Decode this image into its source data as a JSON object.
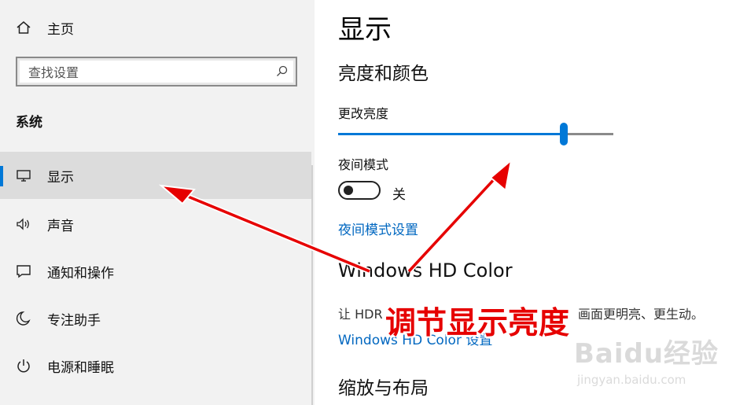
{
  "sidebar": {
    "home_label": "主页",
    "search_placeholder": "查找设置",
    "section_label": "系统",
    "items": [
      {
        "label": "显示",
        "icon": "monitor-icon"
      },
      {
        "label": "声音",
        "icon": "speaker-icon"
      },
      {
        "label": "通知和操作",
        "icon": "notification-icon"
      },
      {
        "label": "专注助手",
        "icon": "moon-icon"
      },
      {
        "label": "电源和睡眠",
        "icon": "power-icon"
      }
    ],
    "selected_index": 0
  },
  "main": {
    "title": "显示",
    "brightness_color_heading": "亮度和颜色",
    "brightness_label": "更改亮度",
    "brightness_value_percent": 82,
    "night_mode_label": "夜间模式",
    "night_mode_state": "关",
    "night_mode_settings_link": "夜间模式设置",
    "hd_color_heading": "Windows HD Color",
    "hd_color_desc_left": "让 HDR",
    "hd_color_desc_right": "画面更明亮、更生动。",
    "hd_color_settings_link": "Windows HD Color 设置",
    "scale_layout_heading": "缩放与布局"
  },
  "annotation": {
    "caption": "调节显示亮度",
    "arrow_color": "#e60000"
  },
  "watermark": {
    "logo": "Baidu经验",
    "url": "jingyan.baidu.com"
  },
  "colors": {
    "accent": "#0078d7",
    "link": "#0067c0",
    "sidebar_bg": "#f2f2f2",
    "selected_bg": "#dcdcdc"
  }
}
